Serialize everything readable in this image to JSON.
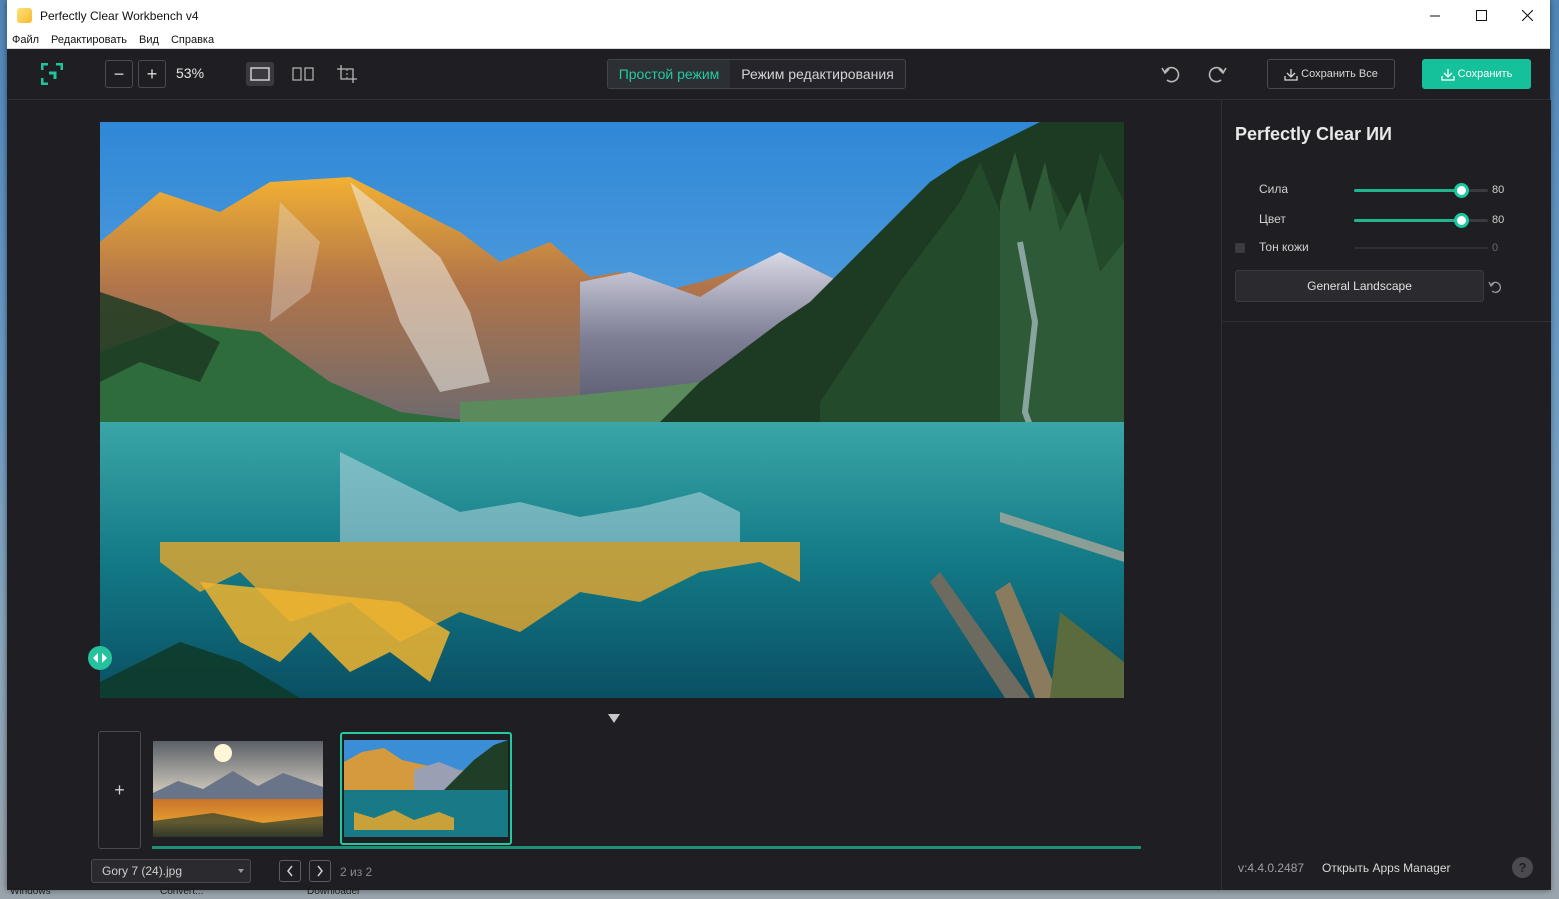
{
  "window": {
    "title": "Perfectly Clear Workbench v4",
    "minimize": "—",
    "maximize": "☐",
    "close": "✕"
  },
  "menu": [
    "Файл",
    "Редактировать",
    "Вид",
    "Справка"
  ],
  "toolbar": {
    "zoom_out": "−",
    "zoom_in": "+",
    "zoom_level": "53%",
    "mode_simple": "Простой режим",
    "mode_edit": "Режим редактирования",
    "save_all": "Сохранить Все",
    "save": "Сохранить"
  },
  "colors": {
    "accent": "#14c19b",
    "background": "#1f1f23"
  },
  "filmstrip": {
    "add": "+",
    "filename": "Gory 7 (24).jpg",
    "page": "2 из 2"
  },
  "panel": {
    "title": "Perfectly Clear ИИ",
    "sliders": [
      {
        "label": "Сила",
        "value": "80",
        "level": 0.8
      },
      {
        "label": "Цвет",
        "value": "80",
        "level": 0.8
      },
      {
        "label": "Тон кожи",
        "value": "0",
        "level": 0
      }
    ],
    "preset": "General Landscape",
    "version": "v:4.4.0.2487",
    "apps_manager": "Открыть Apps Manager",
    "help": "?"
  },
  "taskbar": [
    "Windows",
    "Convert...",
    "Downloader"
  ]
}
